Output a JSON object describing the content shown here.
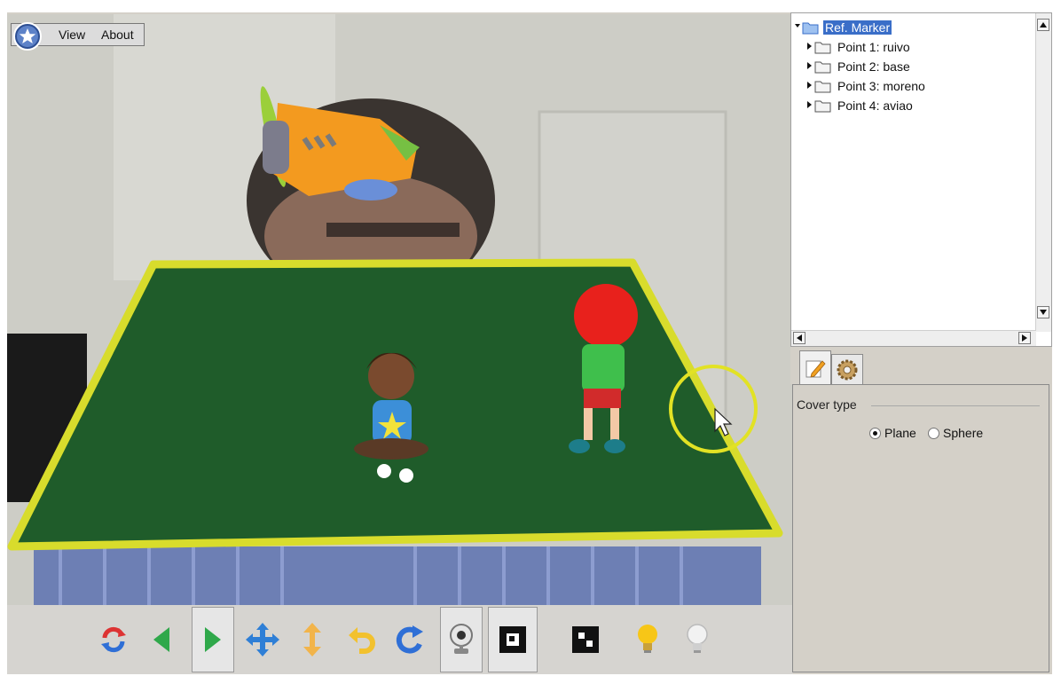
{
  "menubar": {
    "logo_icon": "star-logo-icon",
    "items": [
      {
        "label": "View"
      },
      {
        "label": "About"
      }
    ]
  },
  "toolbar": {
    "buttons": [
      {
        "icon": "refresh-icon"
      },
      {
        "icon": "arrow-left-icon"
      },
      {
        "icon": "arrow-right-icon",
        "pressed": true
      },
      {
        "icon": "move-icon"
      },
      {
        "icon": "move-vertical-icon"
      },
      {
        "icon": "undo-icon"
      },
      {
        "icon": "redo-icon"
      },
      {
        "icon": "webcam-icon",
        "pressed": true
      },
      {
        "icon": "marker-single-icon",
        "pressed": true
      },
      {
        "icon": "marker-multi-icon"
      },
      {
        "icon": "light-on-icon"
      },
      {
        "icon": "light-off-icon"
      }
    ]
  },
  "tree": {
    "root": {
      "label": "Ref. Marker",
      "expanded": true,
      "selected": true
    },
    "children": [
      {
        "label": "Point 1: ruivo"
      },
      {
        "label": "Point 2: base"
      },
      {
        "label": "Point 3: moreno"
      },
      {
        "label": "Point 4: aviao"
      }
    ]
  },
  "tabs": [
    {
      "icon": "edit-icon",
      "active": true
    },
    {
      "icon": "gear-icon",
      "active": false
    }
  ],
  "properties": {
    "group_title": "Cover type",
    "options": [
      {
        "label": "Plane",
        "selected": true
      },
      {
        "label": "Sphere",
        "selected": false
      }
    ]
  },
  "colors": {
    "board_green": "#1f5c2a",
    "board_border": "#d8dc2c",
    "selection_blue": "#3a6ec8"
  }
}
